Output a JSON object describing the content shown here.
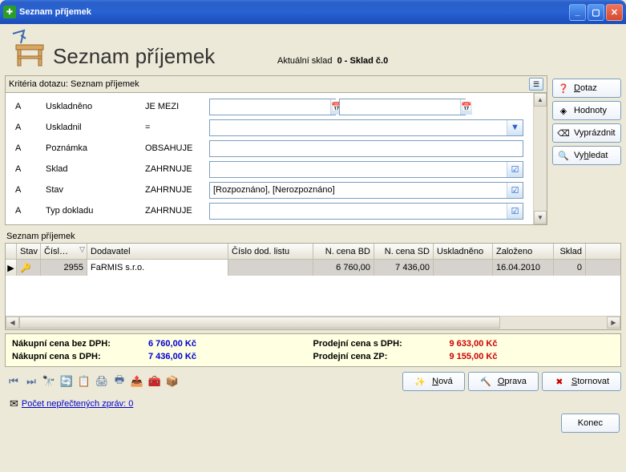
{
  "window": {
    "title": "Seznam příjemek"
  },
  "header": {
    "title": "Seznam příjemek",
    "sklad_label": "Aktuální sklad",
    "sklad_value": "0 - Sklad č.0"
  },
  "criteria": {
    "title": "Kritéria dotazu: Seznam příjemek",
    "rows": [
      {
        "a": "A",
        "field": "Uskladněno",
        "op": "JE MEZI",
        "type": "daterange",
        "val1": "",
        "val2": ""
      },
      {
        "a": "A",
        "field": "Uskladnil",
        "op": "=",
        "type": "combo",
        "val": ""
      },
      {
        "a": "A",
        "field": "Poznámka",
        "op": "OBSAHUJE",
        "type": "text",
        "val": ""
      },
      {
        "a": "A",
        "field": "Sklad",
        "op": "ZAHRNUJE",
        "type": "check",
        "val": ""
      },
      {
        "a": "A",
        "field": "Stav",
        "op": "ZAHRNUJE",
        "type": "check",
        "val": "[Rozpoznáno], [Nerozpoznáno]"
      },
      {
        "a": "A",
        "field": "Typ dokladu",
        "op": "ZAHRNUJE",
        "type": "check",
        "val": ""
      }
    ]
  },
  "side_buttons": {
    "dotaz": "Dotaz",
    "hodnoty": "Hodnoty",
    "vyprazdnit": "Vyprázdnit",
    "vyhledat": "Vyhledat"
  },
  "list": {
    "title": "Seznam příjemek",
    "columns": {
      "stav": "Stav",
      "cisl": "Čísl…",
      "dodavatel": "Dodavatel",
      "cislo_dod": "Číslo dod. listu",
      "n_cena_bd": "N. cena BD",
      "n_cena_sd": "N. cena SD",
      "uskladneno": "Uskladněno",
      "zalozeno": "Založeno",
      "sklad": "Sklad"
    },
    "rows": [
      {
        "cisl": "2955",
        "dodavatel": "FaRMIS s.r.o.",
        "cislo_dod": "",
        "n_cena_bd": "6 760,00",
        "n_cena_sd": "7 436,00",
        "uskladneno": "",
        "zalozeno": "16.04.2010",
        "sklad": "0"
      }
    ]
  },
  "summary": {
    "nc_bez_dph_lbl": "Nákupní cena bez DPH:",
    "nc_bez_dph_val": "6 760,00 Kč",
    "nc_s_dph_lbl": "Nákupní cena s DPH:",
    "nc_s_dph_val": "7 436,00 Kč",
    "pc_s_dph_lbl": "Prodejní cena s DPH:",
    "pc_s_dph_val": "9 633,00 Kč",
    "pc_zp_lbl": "Prodejní cena ZP:",
    "pc_zp_val": "9 155,00 Kč"
  },
  "actions": {
    "nova": "Nová",
    "oprava": "Oprava",
    "stornovat": "Stornovat",
    "konec": "Konec"
  },
  "status": {
    "unread_label": "Počet nepřečtených zpráv: 0"
  }
}
